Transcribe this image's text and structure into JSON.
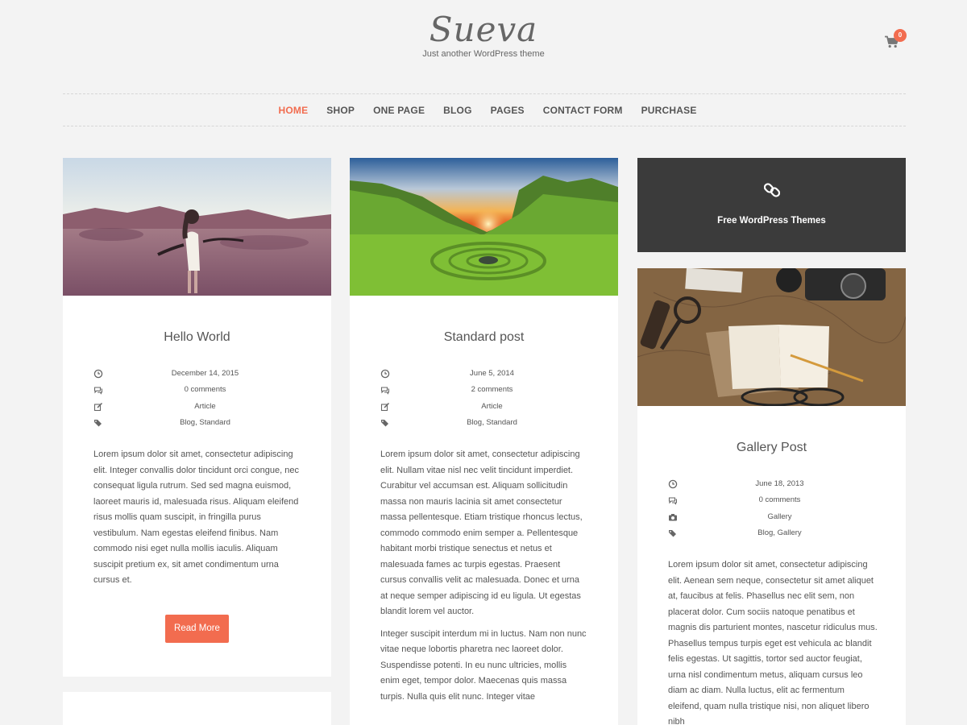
{
  "site": {
    "title": "Sueva",
    "tagline": "Just another WordPress theme",
    "cart_count": "0"
  },
  "nav": {
    "items": [
      "HOME",
      "SHOP",
      "ONE PAGE",
      "BLOG",
      "PAGES",
      "CONTACT FORM",
      "PURCHASE"
    ],
    "active": "HOME"
  },
  "posts": [
    {
      "title": "Hello World",
      "date": "December 14, 2015",
      "comments": "0 comments",
      "format": "Article",
      "categories": "Blog, Standard",
      "excerpt": [
        "Lorem ipsum dolor sit amet, consectetur adipiscing elit. Integer convallis dolor tincidunt orci congue, nec consequat ligula rutrum. Sed sed magna euismod, laoreet mauris id, malesuada risus. Aliquam eleifend risus mollis quam suscipit, in fringilla purus vestibulum. Nam egestas eleifend finibus. Nam commodo nisi eget nulla mollis iaculis. Aliquam suscipit pretium ex, sit amet condimentum urna cursus et."
      ],
      "read_more": "Read More"
    },
    {
      "title": "Standard post",
      "date": "June 5, 2014",
      "comments": "2 comments",
      "format": "Article",
      "categories": "Blog, Standard",
      "excerpt": [
        "Lorem ipsum dolor sit amet, consectetur adipiscing elit. Nullam vitae nisl nec velit tincidunt imperdiet. Curabitur vel accumsan est. Aliquam sollicitudin massa non mauris lacinia sit amet consectetur massa pellentesque. Etiam tristique rhoncus lectus, commodo commodo enim semper a. Pellentesque habitant morbi tristique senectus et netus et malesuada fames ac turpis egestas. Praesent cursus convallis velit ac malesuada. Donec et urna at neque semper adipiscing id eu ligula. Ut egestas blandit lorem vel auctor.",
        "Integer suscipit interdum mi in luctus. Nam non nunc vitae neque lobortis pharetra nec laoreet dolor. Suspendisse potenti. In eu nunc ultricies, mollis enim eget, tempor dolor. Maecenas quis massa turpis. Nulla quis elit nunc. Integer vitae"
      ]
    },
    {
      "title": "Gallery Post",
      "date": "June 18, 2013",
      "comments": "0 comments",
      "format": "Gallery",
      "categories": "Blog, Gallery",
      "excerpt": [
        "Lorem ipsum dolor sit amet, consectetur adipiscing elit. Aenean sem neque, consectetur sit amet aliquet at, faucibus at felis. Phasellus nec elit sem, non placerat dolor. Cum sociis natoque penatibus et magnis dis parturient montes, nascetur ridiculus mus. Phasellus tempus turpis eget est vehicula ac blandit felis egestas. Ut sagittis, tortor sed auctor feugiat, urna nisl condimentum metus, aliquam cursus leo diam ac diam. Nulla luctus, elit ac fermentum eleifend, quam nulla tristique nisi, non aliquet libero nibh"
      ]
    }
  ],
  "link_post": {
    "title": "Free WordPress Themes"
  },
  "icons": {
    "date": "clock-icon",
    "comments": "comments-icon",
    "format_article": "edit-icon",
    "format_gallery": "camera-icon",
    "categories": "tags-icon",
    "link": "link-icon",
    "cart": "cart-icon"
  },
  "colors": {
    "accent": "#f26c4f",
    "dark_card": "#3b3b3b",
    "background": "#f3f3f3"
  }
}
